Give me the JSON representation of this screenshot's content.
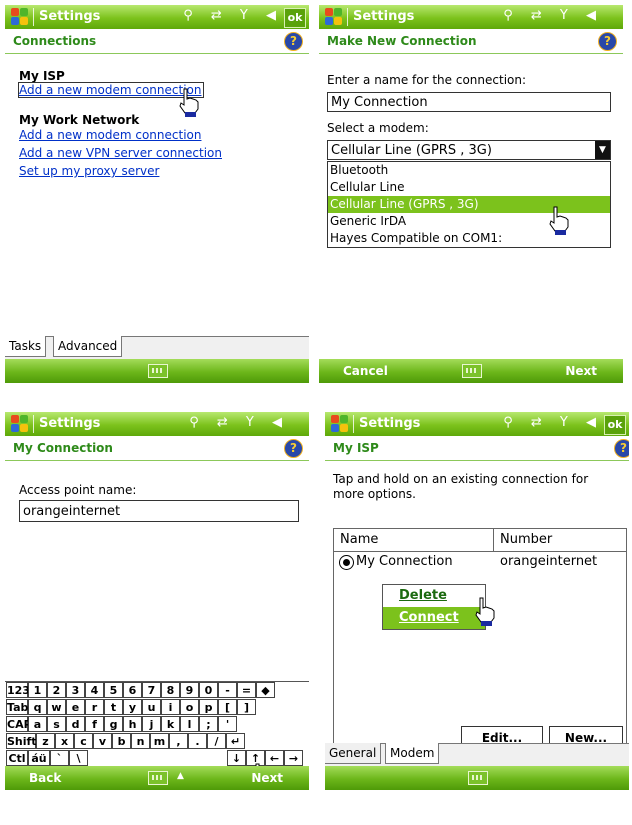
{
  "screens": [
    {
      "title": "Settings",
      "subheader": "Connections",
      "sections": [
        {
          "heading": "My ISP",
          "links": [
            "Add a new modem connection"
          ]
        },
        {
          "heading": "My Work Network",
          "links": [
            "Add a new modem connection",
            "Add a new VPN server connection",
            "Set up my proxy server"
          ]
        }
      ],
      "tabs": [
        "Tasks",
        "Advanced"
      ]
    },
    {
      "title": "Settings",
      "subheader": "Make New Connection",
      "name_label": "Enter a name for the connection:",
      "name_value": "My Connection",
      "modem_label": "Select a modem:",
      "modem_selected": "Cellular Line (GPRS , 3G)",
      "modem_options": [
        "Bluetooth",
        "Cellular Line",
        "Cellular Line (GPRS , 3G)",
        "Generic IrDA",
        "Hayes Compatible on COM1:"
      ],
      "soft_left": "Cancel",
      "soft_right": "Next"
    },
    {
      "title": "Settings",
      "subheader": "My Connection",
      "apn_label": "Access point name:",
      "apn_value": "orangeinternet",
      "keyboard": [
        [
          "123",
          "1",
          "2",
          "3",
          "4",
          "5",
          "6",
          "7",
          "8",
          "9",
          "0",
          "-",
          "=",
          "◆"
        ],
        [
          "Tab",
          "q",
          "w",
          "e",
          "r",
          "t",
          "y",
          "u",
          "i",
          "o",
          "p",
          "[",
          "]"
        ],
        [
          "CAP",
          "a",
          "s",
          "d",
          "f",
          "g",
          "h",
          "j",
          "k",
          "l",
          ";",
          "'"
        ],
        [
          "Shift",
          "z",
          "x",
          "c",
          "v",
          "b",
          "n",
          "m",
          ",",
          ".",
          "/",
          "↵"
        ],
        [
          "Ctl",
          "áü",
          "`",
          "\\",
          "↓",
          "↑",
          "←",
          "→"
        ]
      ],
      "soft_left": "Back",
      "soft_right": "Next"
    },
    {
      "title": "Settings",
      "subheader": "My ISP",
      "instruction": "Tap and hold on an existing connection for more options.",
      "columns": [
        "Name",
        "Number"
      ],
      "row": {
        "name": "My Connection",
        "number": "orangeinternet"
      },
      "context_menu": [
        "Delete",
        "Connect"
      ],
      "buttons": [
        "Edit...",
        "New..."
      ],
      "tabs": [
        "General",
        "Modem"
      ]
    }
  ],
  "status_icons": "⚲ ⇄ Y ◀",
  "ok_label": "ok"
}
